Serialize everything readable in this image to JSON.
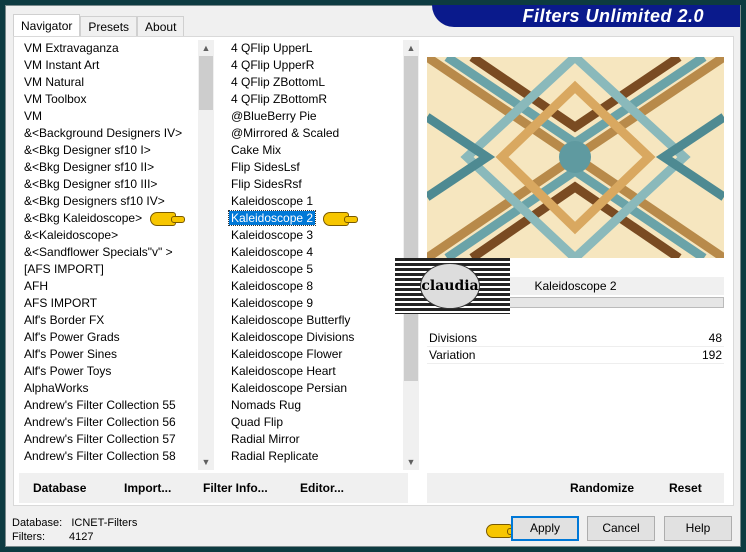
{
  "title": "Filters Unlimited 2.0",
  "tabs": [
    {
      "label": "Navigator"
    },
    {
      "label": "Presets"
    },
    {
      "label": "About"
    }
  ],
  "categories": [
    "VM Extravaganza",
    "VM Instant Art",
    "VM Natural",
    "VM Toolbox",
    "VM",
    "&<Background Designers IV>",
    "&<Bkg Designer sf10 I>",
    "&<Bkg Designer sf10 II>",
    "&<Bkg Designer sf10 III>",
    "&<Bkg Designers sf10 IV>",
    "&<Bkg Kaleidoscope>",
    "&<Kaleidoscope>",
    "&<Sandflower Specials\"v\" >",
    "[AFS IMPORT]",
    "AFH",
    "AFS IMPORT",
    "Alf's Border FX",
    "Alf's Power Grads",
    "Alf's Power Sines",
    "Alf's Power Toys",
    "AlphaWorks",
    "Andrew's Filter Collection 55",
    "Andrew's Filter Collection 56",
    "Andrew's Filter Collection 57",
    "Andrew's Filter Collection 58"
  ],
  "selected_category": "&<Bkg Kaleidoscope>",
  "filters": [
    "4 QFlip UpperL",
    "4 QFlip UpperR",
    "4 QFlip ZBottomL",
    "4 QFlip ZBottomR",
    "@BlueBerry Pie",
    "@Mirrored & Scaled",
    "Cake Mix",
    "Flip SidesLsf",
    "Flip SidesRsf",
    "Kaleidoscope 1",
    "Kaleidoscope 2",
    "Kaleidoscope 3",
    "Kaleidoscope 4",
    "Kaleidoscope 5",
    "Kaleidoscope 8",
    "Kaleidoscope 9",
    "Kaleidoscope Butterfly",
    "Kaleidoscope Divisions",
    "Kaleidoscope Flower",
    "Kaleidoscope Heart",
    "Kaleidoscope Persian",
    "Nomads Rug",
    "Quad Flip",
    "Radial Mirror",
    "Radial Replicate"
  ],
  "selected_filter": "Kaleidoscope 2",
  "filter_name": "Kaleidoscope 2",
  "params": [
    {
      "label": "Divisions",
      "value": "48"
    },
    {
      "label": "Variation",
      "value": "192"
    }
  ],
  "buttons": {
    "database": "Database",
    "import": "Import...",
    "filter_info": "Filter Info...",
    "editor": "Editor...",
    "randomize": "Randomize",
    "reset": "Reset",
    "apply": "Apply",
    "cancel": "Cancel",
    "help": "Help"
  },
  "status": {
    "database_label": "Database:",
    "database_value": "ICNET-Filters",
    "filters_label": "Filters:",
    "filters_value": "4127"
  },
  "watermark": "claudia"
}
